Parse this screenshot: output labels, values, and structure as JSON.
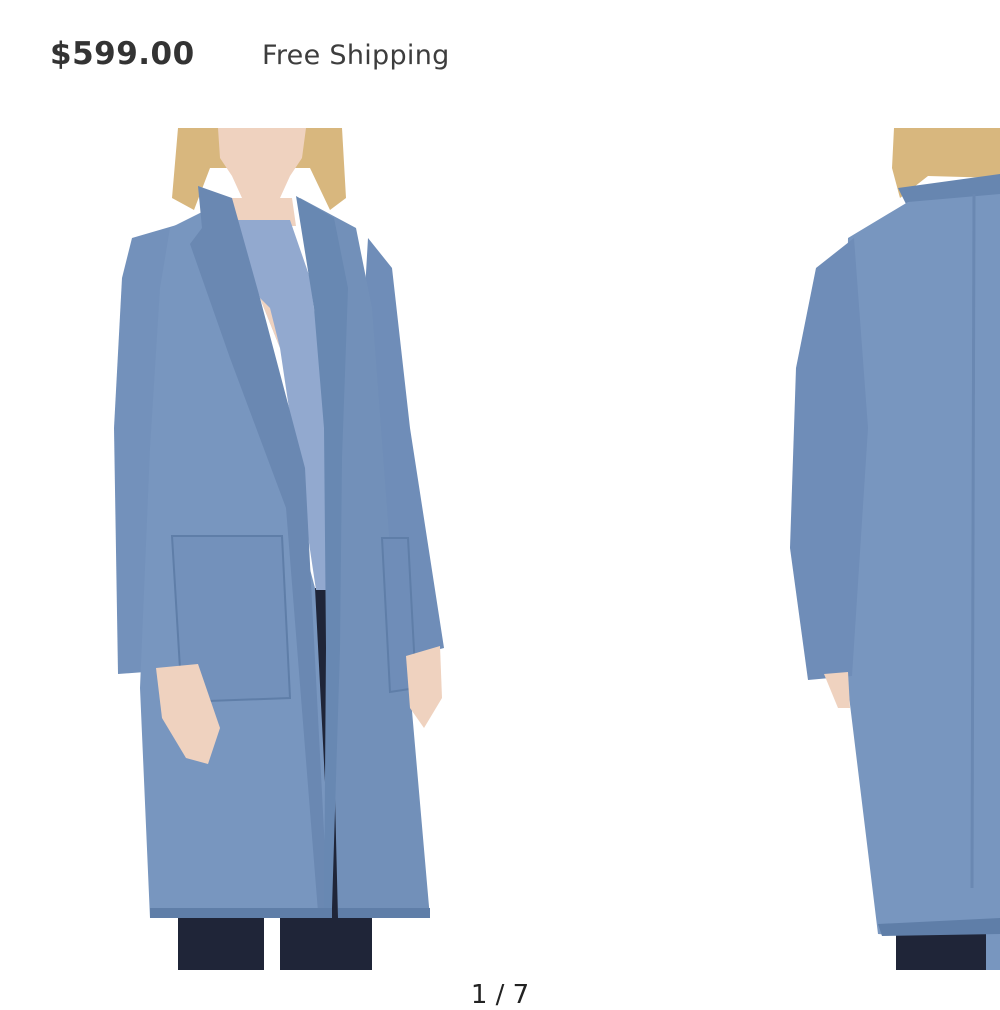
{
  "product": {
    "price": "$599.00",
    "shipping": "Free Shipping"
  },
  "carousel": {
    "pager": "1 / 7",
    "images": [
      {
        "icon": "front-view-coat-image"
      },
      {
        "icon": "back-view-coat-image"
      }
    ]
  },
  "colors": {
    "coat": "#7896bf",
    "coat_shadow": "#5f7ea8",
    "blouse": "#92a9cf",
    "hair": "#d8b77e",
    "skin": "#efd2bf",
    "pants": "#1f2538"
  }
}
